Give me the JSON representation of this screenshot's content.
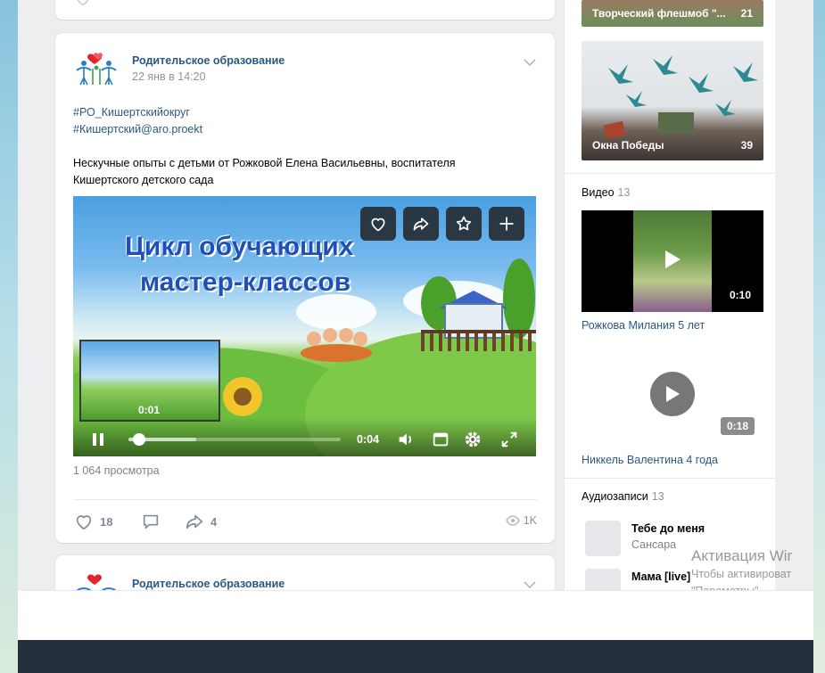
{
  "post": {
    "author": "Родительское образование",
    "date": "22 янв в 14:20",
    "tags": [
      "#РО_Кишертскийокруг",
      "#Кишертский@aro.proekt"
    ],
    "text": "Нескучные опыты с детьми от Рожковой Елена Васильевны, воспитателя Кишертского детского сада",
    "video": {
      "title_line1": "Цикл обучающих",
      "title_line2": "мастер-классов",
      "preview_time": "0:01",
      "current_time": "0:04",
      "progress": 0.05,
      "buffered": 0.32
    },
    "views": "1 064 просмотра",
    "likes": "18",
    "shares": "4",
    "view_count": "1K"
  },
  "next_post": {
    "author": "Родительское образование"
  },
  "sidebar": {
    "albums": [
      {
        "caption": "Творческий флешмоб \"...",
        "count": "21"
      },
      {
        "caption": "Окна Победы",
        "count": "39"
      }
    ],
    "videos_section": {
      "title": "Видео",
      "count": "13"
    },
    "videos": [
      {
        "duration": "0:10",
        "label": "Рожкова Милания 5 лет"
      },
      {
        "duration": "0:18",
        "label": "Никкель Валентина 4 года"
      }
    ],
    "audio_section": {
      "title": "Аудиозаписи",
      "count": "13"
    },
    "audio": [
      {
        "title": "Тебе до меня",
        "artist": "Сансара"
      },
      {
        "title": "Мама [live]",
        "artist": ""
      }
    ]
  },
  "watermark": {
    "line1": "Активация Wir",
    "line2": "Чтобы активироват",
    "line3": "\"Параметры\"."
  },
  "colors": {
    "link": "#2a5885",
    "page_bg": "#edeef0",
    "dark_band": "#23303c"
  }
}
